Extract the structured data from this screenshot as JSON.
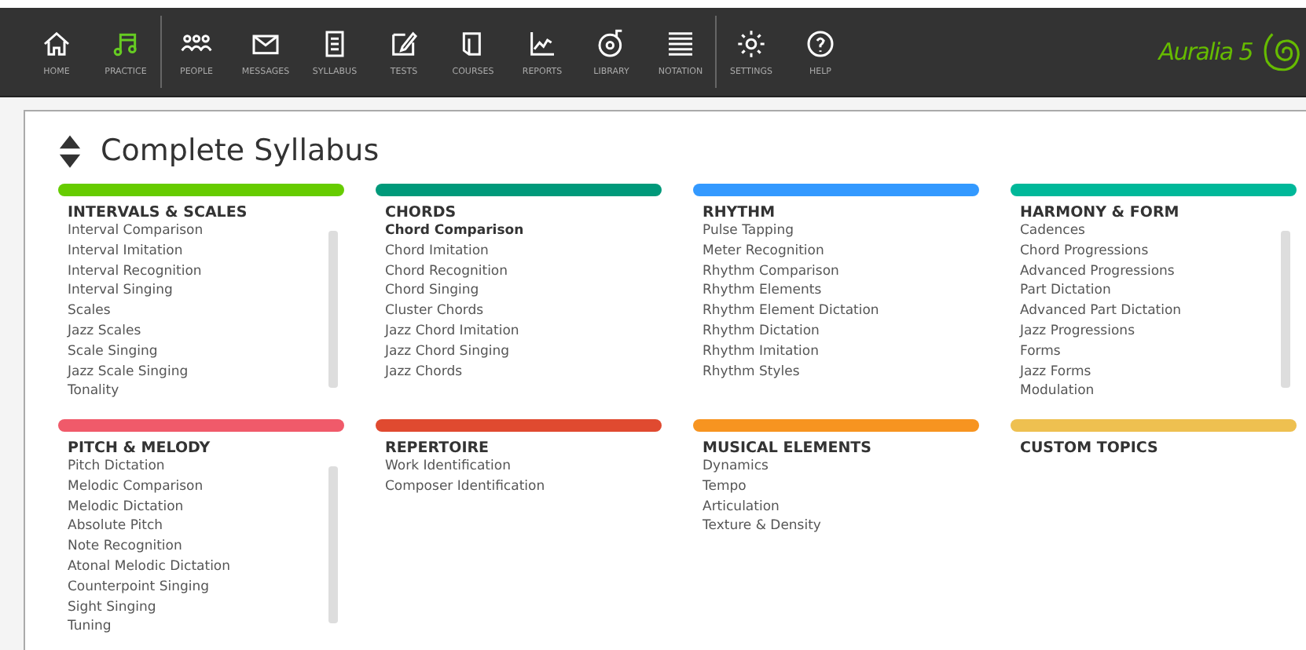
{
  "nav": [
    {
      "label": "HOME",
      "selected": false
    },
    {
      "label": "PRACTICE",
      "selected": true
    },
    {
      "label": "PEOPLE",
      "selected": false
    },
    {
      "label": "MESSAGES",
      "selected": false
    },
    {
      "label": "SYLLABUS",
      "selected": false
    },
    {
      "label": "TESTS",
      "selected": false
    },
    {
      "label": "COURSES",
      "selected": false
    },
    {
      "label": "REPORTS",
      "selected": false
    },
    {
      "label": "LIBRARY",
      "selected": false
    },
    {
      "label": "NOTATION",
      "selected": false
    },
    {
      "label": "SETTINGS",
      "selected": false
    },
    {
      "label": "HELP",
      "selected": false
    }
  ],
  "logo": {
    "text": "Auralia 5"
  },
  "page": {
    "title": "Complete Syllabus"
  },
  "sections": [
    {
      "title": "INTERVALS & SCALES",
      "color": "#66cc00",
      "scrollable": true,
      "items": [
        {
          "label": "Interval Comparison",
          "selected": false
        },
        {
          "label": "Interval Imitation",
          "selected": false
        },
        {
          "label": "Interval Recognition",
          "selected": false
        },
        {
          "label": "Interval Singing",
          "selected": false
        },
        {
          "label": "Scales",
          "selected": false
        },
        {
          "label": "Jazz Scales",
          "selected": false
        },
        {
          "label": "Scale Singing",
          "selected": false
        },
        {
          "label": "Jazz Scale Singing",
          "selected": false
        },
        {
          "label": "Tonality",
          "selected": false
        }
      ]
    },
    {
      "title": "CHORDS",
      "color": "#00997a",
      "scrollable": false,
      "items": [
        {
          "label": "Chord Comparison",
          "selected": true
        },
        {
          "label": "Chord Imitation",
          "selected": false
        },
        {
          "label": "Chord Recognition",
          "selected": false
        },
        {
          "label": "Chord Singing",
          "selected": false
        },
        {
          "label": "Cluster Chords",
          "selected": false
        },
        {
          "label": "Jazz Chord Imitation",
          "selected": false
        },
        {
          "label": "Jazz Chord Singing",
          "selected": false
        },
        {
          "label": "Jazz Chords",
          "selected": false
        }
      ]
    },
    {
      "title": "RHYTHM",
      "color": "#3399ff",
      "scrollable": false,
      "items": [
        {
          "label": "Pulse Tapping",
          "selected": false
        },
        {
          "label": "Meter Recognition",
          "selected": false
        },
        {
          "label": "Rhythm Comparison",
          "selected": false
        },
        {
          "label": "Rhythm Elements",
          "selected": false
        },
        {
          "label": "Rhythm Element Dictation",
          "selected": false
        },
        {
          "label": "Rhythm Dictation",
          "selected": false
        },
        {
          "label": "Rhythm Imitation",
          "selected": false
        },
        {
          "label": "Rhythm Styles",
          "selected": false
        }
      ]
    },
    {
      "title": "HARMONY & FORM",
      "color": "#00b899",
      "scrollable": true,
      "items": [
        {
          "label": "Cadences",
          "selected": false
        },
        {
          "label": "Chord Progressions",
          "selected": false
        },
        {
          "label": "Advanced Progressions",
          "selected": false
        },
        {
          "label": "Part Dictation",
          "selected": false
        },
        {
          "label": "Advanced Part Dictation",
          "selected": false
        },
        {
          "label": "Jazz Progressions",
          "selected": false
        },
        {
          "label": "Forms",
          "selected": false
        },
        {
          "label": "Jazz Forms",
          "selected": false
        },
        {
          "label": "Modulation",
          "selected": false
        }
      ]
    },
    {
      "title": "PITCH & MELODY",
      "color": "#f05a6a",
      "scrollable": true,
      "items": [
        {
          "label": "Pitch Dictation",
          "selected": false
        },
        {
          "label": "Melodic Comparison",
          "selected": false
        },
        {
          "label": "Melodic Dictation",
          "selected": false
        },
        {
          "label": "Absolute Pitch",
          "selected": false
        },
        {
          "label": "Note Recognition",
          "selected": false
        },
        {
          "label": "Atonal Melodic Dictation",
          "selected": false
        },
        {
          "label": "Counterpoint Singing",
          "selected": false
        },
        {
          "label": "Sight Singing",
          "selected": false
        },
        {
          "label": "Tuning",
          "selected": false
        }
      ]
    },
    {
      "title": "REPERTOIRE",
      "color": "#e04a30",
      "scrollable": false,
      "items": [
        {
          "label": "Work Identification",
          "selected": false
        },
        {
          "label": "Composer Identification",
          "selected": false
        }
      ]
    },
    {
      "title": "MUSICAL ELEMENTS",
      "color": "#f79420",
      "scrollable": false,
      "items": [
        {
          "label": "Dynamics",
          "selected": false
        },
        {
          "label": "Tempo",
          "selected": false
        },
        {
          "label": "Articulation",
          "selected": false
        },
        {
          "label": "Texture & Density",
          "selected": false
        }
      ]
    },
    {
      "title": "CUSTOM TOPICS",
      "color": "#eec050",
      "scrollable": false
    }
  ]
}
